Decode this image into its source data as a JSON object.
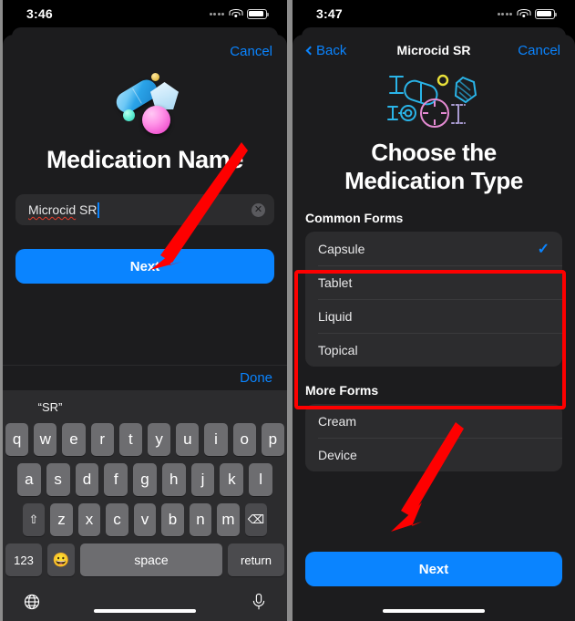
{
  "left_phone": {
    "status_bar": {
      "time": "3:46",
      "cellular_icon": "cellular-dots-icon",
      "wifi_icon": "wifi-icon",
      "battery_icon": "battery-icon"
    },
    "sheet": {
      "cancel_label": "Cancel",
      "hero_icon": "medication-pills-3d-icon",
      "title": "Medication Name",
      "name_field": {
        "value": "Microcid SR",
        "misspelled_part": "Microcid",
        "rest_part": " SR",
        "clear_icon": "clear-text-icon"
      },
      "next_label": "Next"
    },
    "keyboard": {
      "done_label": "Done",
      "predictions": [
        "“SR”",
        "",
        ""
      ],
      "row1": [
        "q",
        "w",
        "e",
        "r",
        "t",
        "y",
        "u",
        "i",
        "o",
        "p"
      ],
      "row2": [
        "a",
        "s",
        "d",
        "f",
        "g",
        "h",
        "j",
        "k",
        "l"
      ],
      "row3": [
        "z",
        "x",
        "c",
        "v",
        "b",
        "n",
        "m"
      ],
      "shift_icon": "shift-arrow-icon",
      "backspace_icon": "backspace-icon",
      "numbers_label": "123",
      "emoji_icon": "emoji-smiley-icon",
      "space_label": "space",
      "return_label": "return",
      "globe_icon": "globe-language-icon",
      "mic_icon": "microphone-icon"
    }
  },
  "right_phone": {
    "status_bar": {
      "time": "3:47",
      "cellular_icon": "cellular-dots-icon",
      "wifi_icon": "wifi-icon",
      "battery_icon": "battery-icon"
    },
    "navbar": {
      "back_label": "Back",
      "back_icon": "chevron-left-icon",
      "title": "Microcid SR",
      "cancel_label": "Cancel"
    },
    "hero_icon": "medication-forms-outline-icon",
    "title_line1": "Choose the",
    "title_line2": "Medication Type",
    "sections": [
      {
        "header": "Common Forms",
        "items": [
          {
            "label": "Capsule",
            "selected": true,
            "check_icon": "checkmark-icon"
          },
          {
            "label": "Tablet",
            "selected": false
          },
          {
            "label": "Liquid",
            "selected": false
          },
          {
            "label": "Topical",
            "selected": false
          }
        ]
      },
      {
        "header": "More Forms",
        "items": [
          {
            "label": "Cream",
            "selected": false
          },
          {
            "label": "Device",
            "selected": false
          }
        ]
      }
    ],
    "next_label": "Next"
  },
  "annotations": {
    "arrow_color": "#fe0000",
    "highlight_box_color": "#fe0000",
    "left_arrow": "red-arrow-to-next-button",
    "right_arrow": "red-arrow-to-next-button",
    "highlight": "red-box-around-common-forms"
  },
  "colors": {
    "accent_blue": "#0a84ff",
    "sheet_bg": "#1c1c1e",
    "row_bg": "#2c2c2e",
    "annotation_red": "#fe0000"
  }
}
